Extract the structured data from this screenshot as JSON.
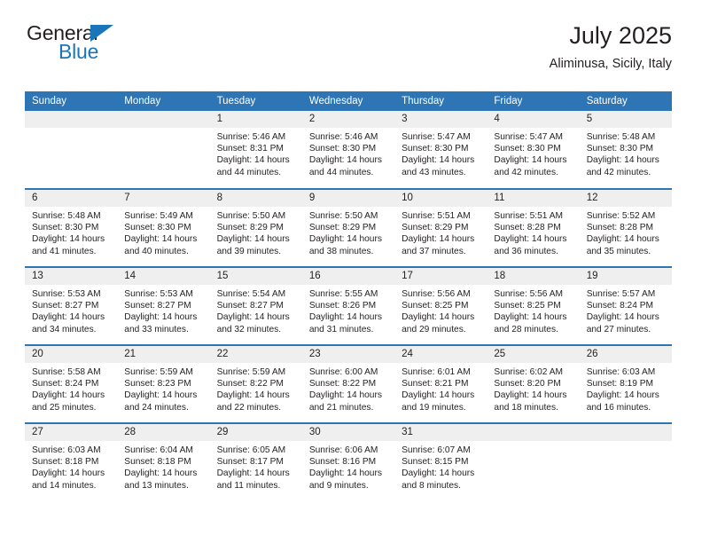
{
  "brand": {
    "name_top": "General",
    "name_bottom": "Blue",
    "triangle_color": "#1b75bb"
  },
  "header": {
    "title": "July 2025",
    "location": "Aliminusa, Sicily, Italy"
  },
  "theme": {
    "header_blue": "#2e75b6",
    "row_rule_blue": "#2e75b6",
    "daynum_band": "#efefef",
    "text": "#231f20"
  },
  "calendar": {
    "weekday_headers": [
      "Sunday",
      "Monday",
      "Tuesday",
      "Wednesday",
      "Thursday",
      "Friday",
      "Saturday"
    ],
    "labels": {
      "sunrise": "Sunrise:",
      "sunset": "Sunset:",
      "daylight": "Daylight:"
    },
    "weeks": [
      [
        {
          "day": "",
          "empty": true,
          "sunrise": "",
          "sunset": "",
          "daylight_l1": "",
          "daylight_l2": ""
        },
        {
          "day": "",
          "empty": true,
          "sunrise": "",
          "sunset": "",
          "daylight_l1": "",
          "daylight_l2": ""
        },
        {
          "day": "1",
          "sunrise": "Sunrise: 5:46 AM",
          "sunset": "Sunset: 8:31 PM",
          "daylight_l1": "Daylight: 14 hours",
          "daylight_l2": "and 44 minutes."
        },
        {
          "day": "2",
          "sunrise": "Sunrise: 5:46 AM",
          "sunset": "Sunset: 8:30 PM",
          "daylight_l1": "Daylight: 14 hours",
          "daylight_l2": "and 44 minutes."
        },
        {
          "day": "3",
          "sunrise": "Sunrise: 5:47 AM",
          "sunset": "Sunset: 8:30 PM",
          "daylight_l1": "Daylight: 14 hours",
          "daylight_l2": "and 43 minutes."
        },
        {
          "day": "4",
          "sunrise": "Sunrise: 5:47 AM",
          "sunset": "Sunset: 8:30 PM",
          "daylight_l1": "Daylight: 14 hours",
          "daylight_l2": "and 42 minutes."
        },
        {
          "day": "5",
          "sunrise": "Sunrise: 5:48 AM",
          "sunset": "Sunset: 8:30 PM",
          "daylight_l1": "Daylight: 14 hours",
          "daylight_l2": "and 42 minutes."
        }
      ],
      [
        {
          "day": "6",
          "sunrise": "Sunrise: 5:48 AM",
          "sunset": "Sunset: 8:30 PM",
          "daylight_l1": "Daylight: 14 hours",
          "daylight_l2": "and 41 minutes."
        },
        {
          "day": "7",
          "sunrise": "Sunrise: 5:49 AM",
          "sunset": "Sunset: 8:30 PM",
          "daylight_l1": "Daylight: 14 hours",
          "daylight_l2": "and 40 minutes."
        },
        {
          "day": "8",
          "sunrise": "Sunrise: 5:50 AM",
          "sunset": "Sunset: 8:29 PM",
          "daylight_l1": "Daylight: 14 hours",
          "daylight_l2": "and 39 minutes."
        },
        {
          "day": "9",
          "sunrise": "Sunrise: 5:50 AM",
          "sunset": "Sunset: 8:29 PM",
          "daylight_l1": "Daylight: 14 hours",
          "daylight_l2": "and 38 minutes."
        },
        {
          "day": "10",
          "sunrise": "Sunrise: 5:51 AM",
          "sunset": "Sunset: 8:29 PM",
          "daylight_l1": "Daylight: 14 hours",
          "daylight_l2": "and 37 minutes."
        },
        {
          "day": "11",
          "sunrise": "Sunrise: 5:51 AM",
          "sunset": "Sunset: 8:28 PM",
          "daylight_l1": "Daylight: 14 hours",
          "daylight_l2": "and 36 minutes."
        },
        {
          "day": "12",
          "sunrise": "Sunrise: 5:52 AM",
          "sunset": "Sunset: 8:28 PM",
          "daylight_l1": "Daylight: 14 hours",
          "daylight_l2": "and 35 minutes."
        }
      ],
      [
        {
          "day": "13",
          "sunrise": "Sunrise: 5:53 AM",
          "sunset": "Sunset: 8:27 PM",
          "daylight_l1": "Daylight: 14 hours",
          "daylight_l2": "and 34 minutes."
        },
        {
          "day": "14",
          "sunrise": "Sunrise: 5:53 AM",
          "sunset": "Sunset: 8:27 PM",
          "daylight_l1": "Daylight: 14 hours",
          "daylight_l2": "and 33 minutes."
        },
        {
          "day": "15",
          "sunrise": "Sunrise: 5:54 AM",
          "sunset": "Sunset: 8:27 PM",
          "daylight_l1": "Daylight: 14 hours",
          "daylight_l2": "and 32 minutes."
        },
        {
          "day": "16",
          "sunrise": "Sunrise: 5:55 AM",
          "sunset": "Sunset: 8:26 PM",
          "daylight_l1": "Daylight: 14 hours",
          "daylight_l2": "and 31 minutes."
        },
        {
          "day": "17",
          "sunrise": "Sunrise: 5:56 AM",
          "sunset": "Sunset: 8:25 PM",
          "daylight_l1": "Daylight: 14 hours",
          "daylight_l2": "and 29 minutes."
        },
        {
          "day": "18",
          "sunrise": "Sunrise: 5:56 AM",
          "sunset": "Sunset: 8:25 PM",
          "daylight_l1": "Daylight: 14 hours",
          "daylight_l2": "and 28 minutes."
        },
        {
          "day": "19",
          "sunrise": "Sunrise: 5:57 AM",
          "sunset": "Sunset: 8:24 PM",
          "daylight_l1": "Daylight: 14 hours",
          "daylight_l2": "and 27 minutes."
        }
      ],
      [
        {
          "day": "20",
          "sunrise": "Sunrise: 5:58 AM",
          "sunset": "Sunset: 8:24 PM",
          "daylight_l1": "Daylight: 14 hours",
          "daylight_l2": "and 25 minutes."
        },
        {
          "day": "21",
          "sunrise": "Sunrise: 5:59 AM",
          "sunset": "Sunset: 8:23 PM",
          "daylight_l1": "Daylight: 14 hours",
          "daylight_l2": "and 24 minutes."
        },
        {
          "day": "22",
          "sunrise": "Sunrise: 5:59 AM",
          "sunset": "Sunset: 8:22 PM",
          "daylight_l1": "Daylight: 14 hours",
          "daylight_l2": "and 22 minutes."
        },
        {
          "day": "23",
          "sunrise": "Sunrise: 6:00 AM",
          "sunset": "Sunset: 8:22 PM",
          "daylight_l1": "Daylight: 14 hours",
          "daylight_l2": "and 21 minutes."
        },
        {
          "day": "24",
          "sunrise": "Sunrise: 6:01 AM",
          "sunset": "Sunset: 8:21 PM",
          "daylight_l1": "Daylight: 14 hours",
          "daylight_l2": "and 19 minutes."
        },
        {
          "day": "25",
          "sunrise": "Sunrise: 6:02 AM",
          "sunset": "Sunset: 8:20 PM",
          "daylight_l1": "Daylight: 14 hours",
          "daylight_l2": "and 18 minutes."
        },
        {
          "day": "26",
          "sunrise": "Sunrise: 6:03 AM",
          "sunset": "Sunset: 8:19 PM",
          "daylight_l1": "Daylight: 14 hours",
          "daylight_l2": "and 16 minutes."
        }
      ],
      [
        {
          "day": "27",
          "sunrise": "Sunrise: 6:03 AM",
          "sunset": "Sunset: 8:18 PM",
          "daylight_l1": "Daylight: 14 hours",
          "daylight_l2": "and 14 minutes."
        },
        {
          "day": "28",
          "sunrise": "Sunrise: 6:04 AM",
          "sunset": "Sunset: 8:18 PM",
          "daylight_l1": "Daylight: 14 hours",
          "daylight_l2": "and 13 minutes."
        },
        {
          "day": "29",
          "sunrise": "Sunrise: 6:05 AM",
          "sunset": "Sunset: 8:17 PM",
          "daylight_l1": "Daylight: 14 hours",
          "daylight_l2": "and 11 minutes."
        },
        {
          "day": "30",
          "sunrise": "Sunrise: 6:06 AM",
          "sunset": "Sunset: 8:16 PM",
          "daylight_l1": "Daylight: 14 hours",
          "daylight_l2": "and 9 minutes."
        },
        {
          "day": "31",
          "sunrise": "Sunrise: 6:07 AM",
          "sunset": "Sunset: 8:15 PM",
          "daylight_l1": "Daylight: 14 hours",
          "daylight_l2": "and 8 minutes."
        },
        {
          "day": "",
          "empty": true,
          "sunrise": "",
          "sunset": "",
          "daylight_l1": "",
          "daylight_l2": ""
        },
        {
          "day": "",
          "empty": true,
          "sunrise": "",
          "sunset": "",
          "daylight_l1": "",
          "daylight_l2": ""
        }
      ]
    ]
  }
}
